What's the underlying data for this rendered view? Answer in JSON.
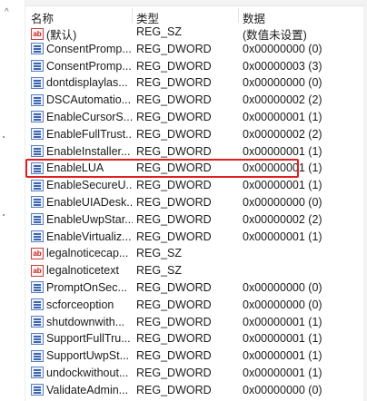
{
  "columns": {
    "name": "名称",
    "type": "类型",
    "data": "数据"
  },
  "rows": [
    {
      "icon": "string-value-icon",
      "icon_text": "ab",
      "name": "(默认)",
      "type": "REG_SZ",
      "data": "(数值未设置)"
    },
    {
      "icon": "dword-value-icon",
      "name": "ConsentPromp...",
      "type": "REG_DWORD",
      "data": "0x00000000 (0)"
    },
    {
      "icon": "dword-value-icon",
      "name": "ConsentPromp...",
      "type": "REG_DWORD",
      "data": "0x00000003 (3)"
    },
    {
      "icon": "dword-value-icon",
      "name": "dontdisplaylas...",
      "type": "REG_DWORD",
      "data": "0x00000000 (0)"
    },
    {
      "icon": "dword-value-icon",
      "name": "DSCAutomatio...",
      "type": "REG_DWORD",
      "data": "0x00000002 (2)"
    },
    {
      "icon": "dword-value-icon",
      "name": "EnableCursorS...",
      "type": "REG_DWORD",
      "data": "0x00000001 (1)"
    },
    {
      "icon": "dword-value-icon",
      "name": "EnableFullTrust...",
      "type": "REG_DWORD",
      "data": "0x00000002 (2)"
    },
    {
      "icon": "dword-value-icon",
      "name": "EnableInstaller...",
      "type": "REG_DWORD",
      "data": "0x00000001 (1)"
    },
    {
      "icon": "dword-value-icon",
      "name": "EnableLUA",
      "type": "REG_DWORD",
      "data": "0x00000001 (1)",
      "highlighted": true
    },
    {
      "icon": "dword-value-icon",
      "name": "EnableSecureU...",
      "type": "REG_DWORD",
      "data": "0x00000001 (1)"
    },
    {
      "icon": "dword-value-icon",
      "name": "EnableUIADesk...",
      "type": "REG_DWORD",
      "data": "0x00000000 (0)"
    },
    {
      "icon": "dword-value-icon",
      "name": "EnableUwpStar...",
      "type": "REG_DWORD",
      "data": "0x00000002 (2)"
    },
    {
      "icon": "dword-value-icon",
      "name": "EnableVirtualiz...",
      "type": "REG_DWORD",
      "data": "0x00000001 (1)"
    },
    {
      "icon": "string-value-icon",
      "icon_text": "ab",
      "name": "legalnoticecap...",
      "type": "REG_SZ",
      "data": ""
    },
    {
      "icon": "string-value-icon",
      "icon_text": "ab",
      "name": "legalnoticetext",
      "type": "REG_SZ",
      "data": ""
    },
    {
      "icon": "dword-value-icon",
      "name": "PromptOnSec...",
      "type": "REG_DWORD",
      "data": "0x00000000 (0)"
    },
    {
      "icon": "dword-value-icon",
      "name": "scforceoption",
      "type": "REG_DWORD",
      "data": "0x00000000 (0)"
    },
    {
      "icon": "dword-value-icon",
      "name": "shutdownwith...",
      "type": "REG_DWORD",
      "data": "0x00000001 (1)"
    },
    {
      "icon": "dword-value-icon",
      "name": "SupportFullTru...",
      "type": "REG_DWORD",
      "data": "0x00000001 (1)"
    },
    {
      "icon": "dword-value-icon",
      "name": "SupportUwpSt...",
      "type": "REG_DWORD",
      "data": "0x00000001 (1)"
    },
    {
      "icon": "dword-value-icon",
      "name": "undockwithout...",
      "type": "REG_DWORD",
      "data": "0x00000001 (1)"
    },
    {
      "icon": "dword-value-icon",
      "name": "ValidateAdmin...",
      "type": "REG_DWORD",
      "data": "0x00000000 (0)"
    }
  ],
  "colors": {
    "highlight_border": "#e02020"
  }
}
